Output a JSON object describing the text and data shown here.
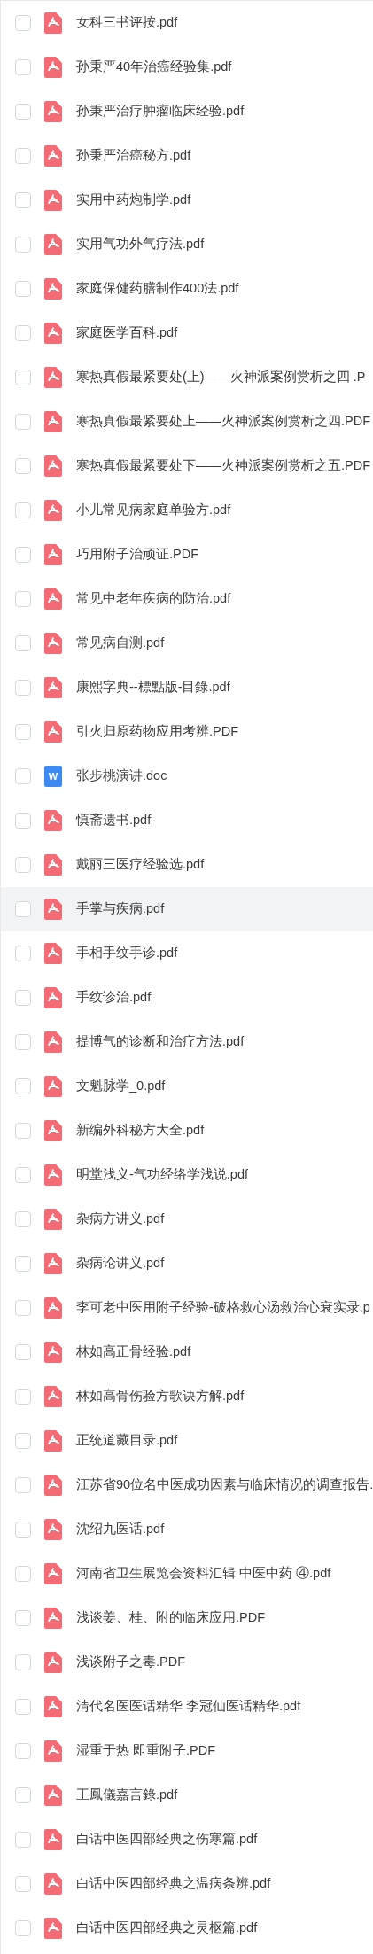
{
  "files": [
    {
      "name": "女科三书评按.pdf",
      "kind": "pdf",
      "checked": false,
      "highlighted": false
    },
    {
      "name": "孙秉严40年治癌经验集.pdf",
      "kind": "pdf",
      "checked": false,
      "highlighted": false
    },
    {
      "name": "孙秉严治疗肿瘤临床经验.pdf",
      "kind": "pdf",
      "checked": false,
      "highlighted": false
    },
    {
      "name": "孙秉严治癌秘方.pdf",
      "kind": "pdf",
      "checked": false,
      "highlighted": false
    },
    {
      "name": "实用中药炮制学.pdf",
      "kind": "pdf",
      "checked": false,
      "highlighted": false
    },
    {
      "name": "实用气功外气疗法.pdf",
      "kind": "pdf",
      "checked": false,
      "highlighted": false
    },
    {
      "name": "家庭保健药膳制作400法.pdf",
      "kind": "pdf",
      "checked": false,
      "highlighted": false
    },
    {
      "name": "家庭医学百科.pdf",
      "kind": "pdf",
      "checked": false,
      "highlighted": false
    },
    {
      "name": "寒热真假最紧要处(上)——火神派案例赏析之四 .P",
      "kind": "pdf",
      "checked": false,
      "highlighted": false
    },
    {
      "name": "寒热真假最紧要处上——火神派案例赏析之四.PDF",
      "kind": "pdf",
      "checked": false,
      "highlighted": false
    },
    {
      "name": "寒热真假最紧要处下——火神派案例赏析之五.PDF",
      "kind": "pdf",
      "checked": false,
      "highlighted": false
    },
    {
      "name": "小儿常见病家庭单验方.pdf",
      "kind": "pdf",
      "checked": false,
      "highlighted": false
    },
    {
      "name": "巧用附子治顽证.PDF",
      "kind": "pdf",
      "checked": false,
      "highlighted": false
    },
    {
      "name": "常见中老年疾病的防治.pdf",
      "kind": "pdf",
      "checked": false,
      "highlighted": false
    },
    {
      "name": "常见病自测.pdf",
      "kind": "pdf",
      "checked": false,
      "highlighted": false
    },
    {
      "name": "康熙字典--標點版-目錄.pdf",
      "kind": "pdf",
      "checked": false,
      "highlighted": false
    },
    {
      "name": "引火归原药物应用考辨.PDF",
      "kind": "pdf",
      "checked": false,
      "highlighted": false
    },
    {
      "name": "张步桃演讲.doc",
      "kind": "doc",
      "icon_text": "W",
      "checked": false,
      "highlighted": false
    },
    {
      "name": "慎斋遗书.pdf",
      "kind": "pdf",
      "checked": false,
      "highlighted": false
    },
    {
      "name": "戴丽三医疗经验选.pdf",
      "kind": "pdf",
      "checked": false,
      "highlighted": false
    },
    {
      "name": "手掌与疾病.pdf",
      "kind": "pdf",
      "checked": false,
      "highlighted": true
    },
    {
      "name": "手相手纹手诊.pdf",
      "kind": "pdf",
      "checked": false,
      "highlighted": false
    },
    {
      "name": "手纹诊治.pdf",
      "kind": "pdf",
      "checked": false,
      "highlighted": false
    },
    {
      "name": "提博气的诊断和治疗方法.pdf",
      "kind": "pdf",
      "checked": false,
      "highlighted": false
    },
    {
      "name": "文魁脉学_0.pdf",
      "kind": "pdf",
      "checked": false,
      "highlighted": false
    },
    {
      "name": "新编外科秘方大全.pdf",
      "kind": "pdf",
      "checked": false,
      "highlighted": false
    },
    {
      "name": "明堂浅义-气功经络学浅说.pdf",
      "kind": "pdf",
      "checked": false,
      "highlighted": false
    },
    {
      "name": "杂病方讲义.pdf",
      "kind": "pdf",
      "checked": false,
      "highlighted": false
    },
    {
      "name": "杂病论讲义.pdf",
      "kind": "pdf",
      "checked": false,
      "highlighted": false
    },
    {
      "name": "李可老中医用附子经验-破格救心汤救治心衰实录.p",
      "kind": "pdf",
      "checked": false,
      "highlighted": false
    },
    {
      "name": "林如高正骨经验.pdf",
      "kind": "pdf",
      "checked": false,
      "highlighted": false
    },
    {
      "name": "林如高骨伤验方歌诀方解.pdf",
      "kind": "pdf",
      "checked": false,
      "highlighted": false
    },
    {
      "name": "正统道藏目录.pdf",
      "kind": "pdf",
      "checked": false,
      "highlighted": false
    },
    {
      "name": "江苏省90位名中医成功因素与临床情况的调查报告.",
      "kind": "pdf",
      "checked": false,
      "highlighted": false
    },
    {
      "name": "沈绍九医话.pdf",
      "kind": "pdf",
      "checked": false,
      "highlighted": false
    },
    {
      "name": "河南省卫生展览会资料汇辑  中医中药 ④.pdf",
      "kind": "pdf",
      "checked": false,
      "highlighted": false
    },
    {
      "name": "浅谈姜、桂、附的临床应用.PDF",
      "kind": "pdf",
      "checked": false,
      "highlighted": false
    },
    {
      "name": "浅谈附子之毒.PDF",
      "kind": "pdf",
      "checked": false,
      "highlighted": false
    },
    {
      "name": "清代名医医话精华  李冠仙医话精华.pdf",
      "kind": "pdf",
      "checked": false,
      "highlighted": false
    },
    {
      "name": "湿重于热  即重附子.PDF",
      "kind": "pdf",
      "checked": false,
      "highlighted": false
    },
    {
      "name": "王鳳儀嘉言錄.pdf",
      "kind": "pdf",
      "checked": false,
      "highlighted": false
    },
    {
      "name": "白话中医四部经典之伤寒篇.pdf",
      "kind": "pdf",
      "checked": false,
      "highlighted": false
    },
    {
      "name": "白话中医四部经典之温病条辨.pdf",
      "kind": "pdf",
      "checked": false,
      "highlighted": false
    },
    {
      "name": "白话中医四部经典之灵枢篇.pdf",
      "kind": "pdf",
      "checked": false,
      "highlighted": false
    }
  ]
}
